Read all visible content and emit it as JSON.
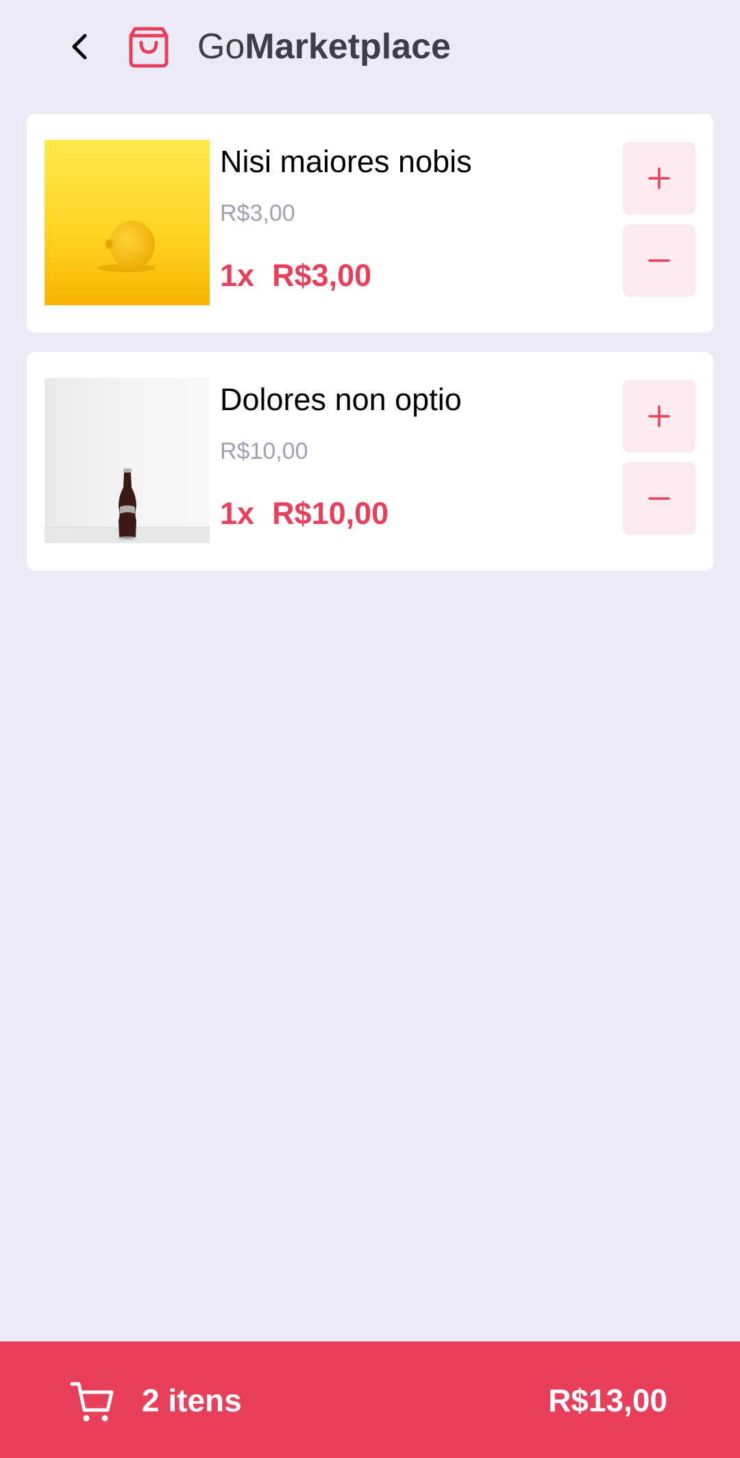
{
  "header": {
    "brand_prefix": "Go",
    "brand_main": "Marketplace",
    "back_icon": "chevron-left-icon",
    "logo_icon": "shopping-bag-icon"
  },
  "cart": {
    "items": [
      {
        "title": "Nisi maiores nobis",
        "unit_price": "R$3,00",
        "quantity": "1x",
        "total": "R$3,00",
        "image": "lemon-on-yellow-photo"
      },
      {
        "title": "Dolores non optio",
        "unit_price": "R$10,00",
        "quantity": "1x",
        "total": "R$10,00",
        "image": "cola-bottle-on-white-photo"
      }
    ]
  },
  "footer": {
    "count": "2 itens",
    "total": "R$13,00",
    "cart_icon": "cart-icon"
  },
  "colors": {
    "accent": "#E83F5B",
    "background": "#EBEBF7",
    "button_bg": "#FBEAED",
    "muted_text": "#A0A0B3",
    "brand_text": "#3D3D4D"
  }
}
